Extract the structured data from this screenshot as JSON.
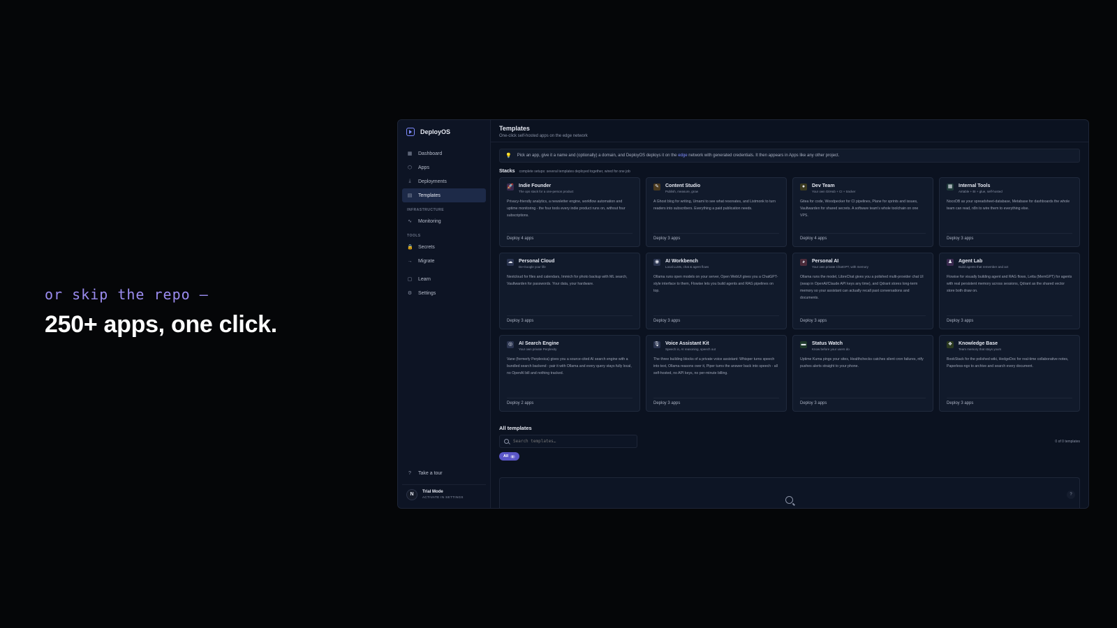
{
  "hero": {
    "kicker": "or skip the repo —",
    "title": "250+ apps, one click."
  },
  "sidebar": {
    "brand": "DeployOS",
    "items": [
      {
        "icon": "▦",
        "label": "Dashboard"
      },
      {
        "icon": "⬡",
        "label": "Apps"
      },
      {
        "icon": "⤓",
        "label": "Deployments"
      },
      {
        "icon": "▤",
        "label": "Templates"
      }
    ],
    "sections": [
      {
        "title": "INFRASTRUCTURE",
        "items": [
          {
            "icon": "∿",
            "label": "Monitoring"
          }
        ]
      },
      {
        "title": "TOOLS",
        "items": [
          {
            "icon": "🔒",
            "label": "Secrets"
          },
          {
            "icon": "→",
            "label": "Migrate"
          }
        ]
      }
    ],
    "extra": [
      {
        "icon": "▢",
        "label": "Learn"
      },
      {
        "icon": "⚙",
        "label": "Settings"
      }
    ],
    "tour": {
      "icon": "?",
      "label": "Take a tour"
    },
    "trial": {
      "avatar": "N",
      "title": "Trial Mode",
      "subtitle": "ACTIVATE IN SETTINGS"
    }
  },
  "main": {
    "title": "Templates",
    "subtitle": "One-click self-hosted apps on the edge network",
    "banner": {
      "before": "Pick an app, give it a name and (optionally) a domain, and DeployOS deploys it on the",
      "link": "edge",
      "after": "network with generated credentials. It then appears in Apps like any other project."
    },
    "stacks_title": "Stacks",
    "stacks_subtitle": "complete setups: several templates deployed together, wired for one job",
    "all_title": "All templates",
    "search_placeholder": "Search templates…",
    "count": "0 of 0 templates",
    "filter": {
      "label": "All",
      "count": "0"
    },
    "help": "?"
  },
  "cards": [
    {
      "icon": "🚀",
      "color": "#3a2b4f",
      "title": "Indie Founder",
      "subtitle": "The ops stack for a one-person product",
      "desc": "Privacy-friendly analytics, a newsletter engine, workflow automation and uptime monitoring - the four tools every indie product runs on, without four subscriptions.",
      "deploy": "Deploy 4 apps"
    },
    {
      "icon": "✎",
      "color": "#4a3a1f",
      "title": "Content Studio",
      "subtitle": "Publish, measure, grow",
      "desc": "A Ghost blog for writing, Umami to see what resonates, and Listmonk to turn readers into subscribers. Everything a paid publication needs.",
      "deploy": "Deploy 3 apps"
    },
    {
      "icon": "●",
      "color": "#3b3a20",
      "title": "Dev Team",
      "subtitle": "Your own GitHub + CI + tracker",
      "desc": "Gitea for code, Woodpecker for CI pipelines, Plane for sprints and issues, Vaultwarden for shared secrets. A software team's whole toolchain on one VPS.",
      "deploy": "Deploy 4 apps"
    },
    {
      "icon": "▦",
      "color": "#1f3a3a",
      "title": "Internal Tools",
      "subtitle": "Airtable + BI + glue, self-hosted",
      "desc": "NocoDB as your spreadsheet-database, Metabase for dashboards the whole team can read, n8n to wire them to everything else.",
      "deploy": "Deploy 3 apps"
    },
    {
      "icon": "☁",
      "color": "#2b3550",
      "title": "Personal Cloud",
      "subtitle": "De-Google your life",
      "desc": "Nextcloud for files and calendars, Immich for photo backup with ML search, Vaultwarden for passwords. Your data, your hardware.",
      "deploy": "Deploy 3 apps"
    },
    {
      "icon": "◉",
      "color": "#2b3550",
      "title": "AI Workbench",
      "subtitle": "Local LLMs, chat & agent flows",
      "desc": "Ollama runs open models on your server, Open WebUI gives you a ChatGPT-style interface to them, Flowise lets you build agents and RAG pipelines on top.",
      "deploy": "Deploy 3 apps"
    },
    {
      "icon": "◕",
      "color": "#4a2b3a",
      "title": "Personal AI",
      "subtitle": "Your own private ChatGPT, with memory",
      "desc": "Ollama runs the model, LibreChat gives you a polished multi-provider chat UI (swap in OpenAI/Claude API keys any time), and Qdrant stores long-term memory so your assistant can actually recall past conversations and documents.",
      "deploy": "Deploy 3 apps"
    },
    {
      "icon": "♟",
      "color": "#3a2b4f",
      "title": "Agent Lab",
      "subtitle": "Build agents that remember and act",
      "desc": "Flowise for visually building agent and RAG flows, Letta (MemGPT) for agents with real persistent memory across sessions, Qdrant as the shared vector store both draw on.",
      "deploy": "Deploy 3 apps"
    },
    {
      "icon": "◎",
      "color": "#2b3550",
      "title": "AI Search Engine",
      "subtitle": "Your own private Perplexity",
      "desc": "Vane (formerly Perplexica) gives you a source-cited AI search engine with a bundled search backend - pair it with Ollama and every query stays fully local, no OpenAI bill and nothing tracked.",
      "deploy": "Deploy 2 apps"
    },
    {
      "icon": "🎙",
      "color": "#2b3550",
      "title": "Voice Assistant Kit",
      "subtitle": "Speech in, AI reasoning, speech out",
      "desc": "The three building blocks of a private voice assistant: Whisper turns speech into text, Ollama reasons over it, Piper turns the answer back into speech - all self-hosted, no API keys, no per-minute billing.",
      "deploy": "Deploy 3 apps"
    },
    {
      "icon": "▬",
      "color": "#1f3a2b",
      "title": "Status Watch",
      "subtitle": "Know before your users do",
      "desc": "Uptime Kuma pings your sites, Healthchecks catches silent cron failures, ntfy pushes alerts straight to your phone.",
      "deploy": "Deploy 3 apps"
    },
    {
      "icon": "❖",
      "color": "#2b3a20",
      "title": "Knowledge Base",
      "subtitle": "Team memory that stays yours",
      "desc": "BookStack for the polished wiki, HedgeDoc for real-time collaborative notes, Paperless-ngx to archive and search every document.",
      "deploy": "Deploy 3 apps"
    }
  ]
}
